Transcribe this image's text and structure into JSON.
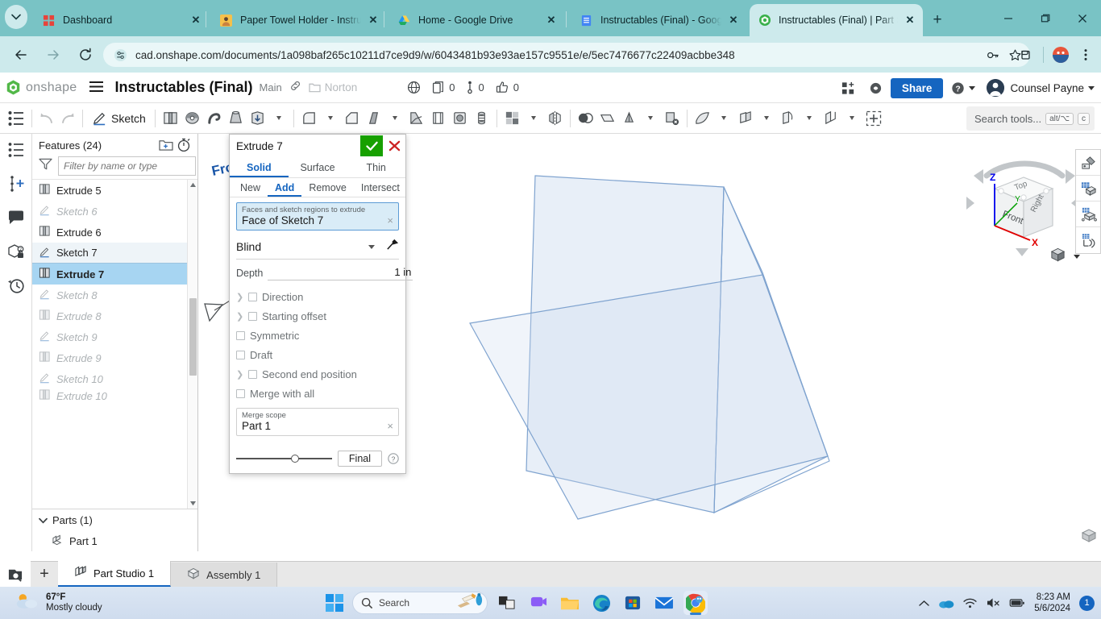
{
  "browser": {
    "tabs": [
      {
        "title": "Dashboard",
        "favicon": "onshape-dashboard-icon",
        "active": false
      },
      {
        "title": "Paper Towel Holder - Instruc",
        "favicon": "instructables-icon",
        "active": false
      },
      {
        "title": "Home - Google Drive",
        "favicon": "google-drive-icon",
        "active": false
      },
      {
        "title": "Instructables (Final) - Google",
        "favicon": "google-docs-icon",
        "active": false
      },
      {
        "title": "Instructables (Final) | Part Stu",
        "favicon": "onshape-icon",
        "active": true
      }
    ],
    "new_tab_label": "+",
    "window_controls": {
      "minimize": "—",
      "maximize": "❐",
      "close": "✕"
    },
    "url": "cad.onshape.com/documents/1a098baf265c10211d7ce9d9/w/6043481b93e93ae157c9551e/e/5ec7476677c22409acbbe348",
    "url_domain": "cad.onshape.com",
    "url_path": "/documents/1a098baf265c10211d7ce9d9/w/6043481b93e93ae157c9551e/e/5ec7476677c22409acbbe348",
    "back_label": "Back",
    "forward_label": "Forward",
    "reload_label": "Reload"
  },
  "onshape_header": {
    "brand": "onshape",
    "document_title": "Instructables (Final)",
    "branch": "Main",
    "folder": "Norton",
    "counters": [
      {
        "name": "versions-count",
        "value": "0"
      },
      {
        "name": "branches-count",
        "value": "0"
      },
      {
        "name": "likes-count",
        "value": "0"
      }
    ],
    "share_label": "Share",
    "user_name": "Counsel Payne"
  },
  "toolbar": {
    "sketch_label": "Sketch",
    "search_placeholder": "Search tools...",
    "search_shortcut_1": "alt/⌥",
    "search_shortcut_2": "c",
    "icons": [
      "feature-list-icon",
      "undo-icon",
      "redo-icon",
      "sketch-icon",
      "extrude-icon",
      "revolve-icon",
      "sweep-icon",
      "loft-icon",
      "thicken-icon",
      "fillet-icon",
      "chamfer-icon",
      "draft-icon",
      "rib-icon",
      "shell-icon",
      "hole-icon",
      "thread-icon",
      "boolean-icon",
      "split-icon",
      "transform-icon",
      "mirror-icon",
      "pattern-icon",
      "delete-face-icon",
      "move-face-icon",
      "plane-icon",
      "sketch-plane-icon",
      "curve-icon",
      "reference-icon"
    ]
  },
  "left_rail": {
    "items": [
      {
        "name": "feature-list-rail-icon",
        "label": "Feature list"
      },
      {
        "name": "add-comment-icon",
        "label": "Comments"
      },
      {
        "name": "comment-bubble-icon",
        "label": "Discussion"
      },
      {
        "name": "parts-properties-icon",
        "label": "Part properties"
      },
      {
        "name": "history-icon",
        "label": "History"
      }
    ]
  },
  "features_panel": {
    "title": "Features (24)",
    "folder_icon": "new-folder-icon",
    "rollback_icon": "rollback-timer-icon",
    "filter_icon": "filter-funnel-icon",
    "filter_placeholder": "Filter by name or type",
    "items": [
      {
        "label": "Extrude 5",
        "icon": "extrude-icon",
        "state": "normal"
      },
      {
        "label": "Sketch 6",
        "icon": "sketch-icon",
        "state": "greyed"
      },
      {
        "label": "Extrude 6",
        "icon": "extrude-icon",
        "state": "normal"
      },
      {
        "label": "Sketch 7",
        "icon": "sketch-icon",
        "state": "selected-light"
      },
      {
        "label": "Extrude 7",
        "icon": "extrude-icon",
        "state": "selected-strong"
      },
      {
        "label": "Sketch 8",
        "icon": "sketch-icon",
        "state": "greyed"
      },
      {
        "label": "Extrude 8",
        "icon": "extrude-icon",
        "state": "greyed"
      },
      {
        "label": "Sketch 9",
        "icon": "sketch-icon",
        "state": "greyed"
      },
      {
        "label": "Extrude 9",
        "icon": "extrude-icon",
        "state": "greyed"
      },
      {
        "label": "Sketch 10",
        "icon": "sketch-icon",
        "state": "greyed"
      },
      {
        "label": "Extrude 10",
        "icon": "extrude-icon",
        "state": "greyed"
      }
    ],
    "parts_title": "Parts (1)",
    "parts": [
      {
        "label": "Part 1",
        "icon": "part-icon"
      }
    ]
  },
  "extrude_dialog": {
    "title": "Extrude 7",
    "confirm_label": "✓",
    "cancel_label": "✕",
    "type_tabs": [
      {
        "label": "Solid",
        "active": true
      },
      {
        "label": "Surface",
        "active": false
      },
      {
        "label": "Thin",
        "active": false
      }
    ],
    "op_tabs": [
      {
        "label": "New",
        "active": false
      },
      {
        "label": "Add",
        "active": true
      },
      {
        "label": "Remove",
        "active": false
      },
      {
        "label": "Intersect",
        "active": false
      }
    ],
    "faces_field": {
      "label": "Faces and sketch regions to extrude",
      "value": "Face of Sketch 7",
      "clear": "×"
    },
    "end_condition": "Blind",
    "flip_icon": "flip-direction-icon",
    "depth_label": "Depth",
    "depth_value": "1 in",
    "options": [
      {
        "label": "Direction",
        "expandable": true,
        "checked": false
      },
      {
        "label": "Starting offset",
        "expandable": true,
        "checked": false
      },
      {
        "label": "Symmetric",
        "expandable": false,
        "checked": false
      },
      {
        "label": "Draft",
        "expandable": false,
        "checked": false
      },
      {
        "label": "Second end position",
        "expandable": true,
        "checked": false
      },
      {
        "label": "Merge with all",
        "expandable": false,
        "checked": false
      }
    ],
    "merge_scope": {
      "label": "Merge scope",
      "value": "Part 1",
      "clear": "×"
    },
    "final_button": "Final",
    "help_icon": "help-question-icon"
  },
  "viewport": {
    "planes": [
      {
        "label": "Front",
        "color": "#1a56a8"
      },
      {
        "label": "Top",
        "color": "#1a56a8"
      },
      {
        "label": "Right",
        "color": "#1a56a8"
      }
    ],
    "plane_fill": "#bcd2ec",
    "plane_stroke": "#7fa3cf",
    "part_color": "#8fafc4",
    "highlight_color": "#f5a623",
    "view_cube": {
      "faces": [
        "Top",
        "Front",
        "Right"
      ],
      "axes": [
        {
          "label": "Z",
          "color": "#0000ee"
        },
        {
          "label": "Y",
          "color": "#00a000"
        },
        {
          "label": "X",
          "color": "#e00000"
        }
      ]
    },
    "display_style_icon": "shaded-cube-icon",
    "right_tools": [
      {
        "name": "appearance-icon"
      },
      {
        "name": "measure-grid-icon"
      },
      {
        "name": "mass-properties-icon"
      },
      {
        "name": "display-state-icon"
      }
    ],
    "zoom_fit_icon": "zoom-to-fit-icon"
  },
  "doc_tabs": {
    "search_icon": "element-search-icon",
    "add_label": "+",
    "tabs": [
      {
        "label": "Part Studio 1",
        "icon": "part-studio-icon",
        "active": true
      },
      {
        "label": "Assembly 1",
        "icon": "assembly-icon",
        "active": false
      }
    ]
  },
  "taskbar": {
    "weather": {
      "temp": "67°F",
      "condition": "Mostly cloudy",
      "icon": "partly-cloudy-icon"
    },
    "start_label": "Start",
    "search_placeholder": "Search",
    "apps": [
      {
        "name": "task-view-icon"
      },
      {
        "name": "teams-icon"
      },
      {
        "name": "file-explorer-icon"
      },
      {
        "name": "edge-icon"
      },
      {
        "name": "microsoft-store-icon"
      },
      {
        "name": "mail-icon"
      },
      {
        "name": "chrome-icon",
        "active": true
      }
    ],
    "tray": {
      "chevron": "show-hidden-icons",
      "onedrive": "onedrive-icon",
      "wifi": "wifi-icon",
      "volume": "volume-muted-icon",
      "battery": "battery-icon",
      "time": "8:23 AM",
      "date": "5/6/2024",
      "notification_count": "1"
    }
  }
}
